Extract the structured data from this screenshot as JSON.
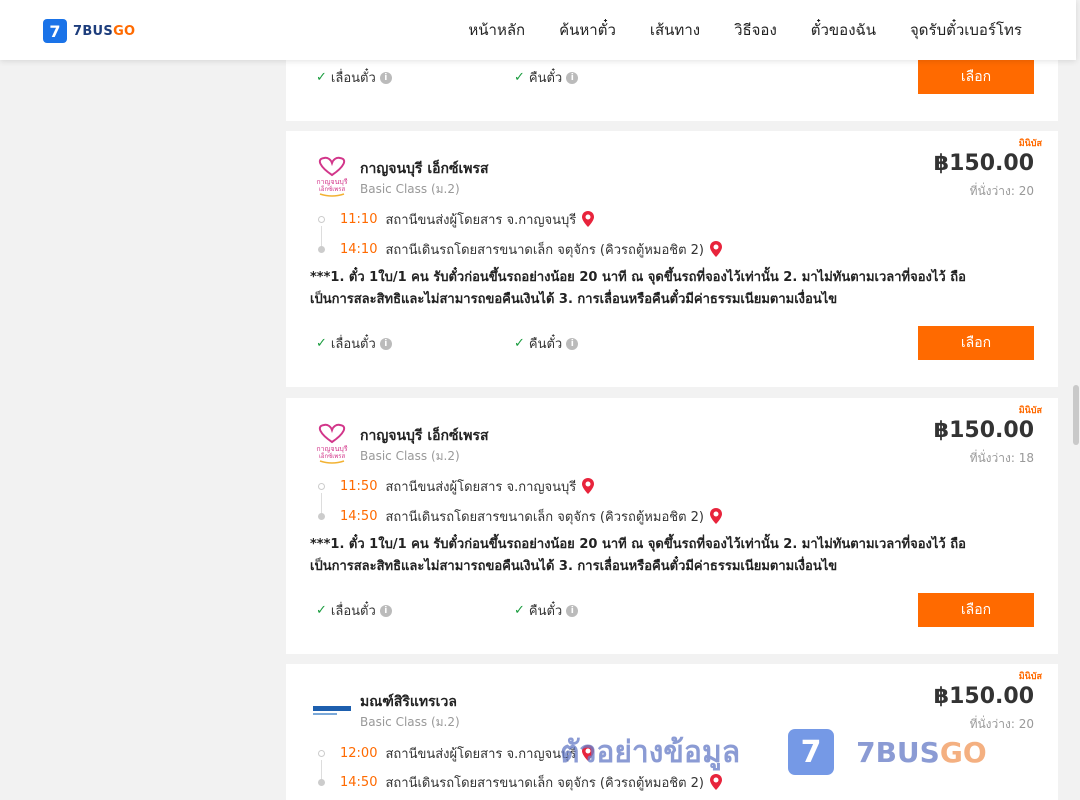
{
  "header": {
    "logo_mark": "7",
    "logo_text_1": "7BUS",
    "logo_text_2": "GO",
    "nav": [
      "หน้าหลัก",
      "ค้นหาตั๋ว",
      "เส้นทาง",
      "วิธีจอง",
      "ตั๋วของฉัน",
      "จุดรับตั๋วเบอร์โทร"
    ]
  },
  "options": {
    "change_label": "เลื่อนตั๋ว",
    "refund_label": "คืนตั๋ว",
    "info_glyph": "i",
    "check_glyph": "✓",
    "select_label": "เลือก"
  },
  "trips": [
    {
      "tag": "มินิบัส",
      "operator": "กาญจนบุรี เอ็กซ์เพรส",
      "class": "Basic Class (ม.2)",
      "price": "฿150.00",
      "seats": "ที่นั่งว่าง: 20",
      "depart_time": "11:10",
      "depart_station": "สถานีขนส่งผู้โดยสาร จ.กาญจนบุรี",
      "arrive_time": "14:10",
      "arrive_station": "สถานีเดินรถโดยสารขนาดเล็ก จตุจักร (คิวรถตู้หมอชิต 2)",
      "note_1": "***1. ตั๋ว 1ใบ/1 คน รับตั๋วก่อนขึ้นรถอย่างน้อย 20 นาที ณ จุดขึ้นรถที่จองไว้เท่านั้น 2. มาไม่ทันตามเวลาที่จองไว้ ถือ",
      "note_2": "เป็นการสละสิทธิและไม่สามารถขอคืนเงินได้ 3. การเลื่อนหรือคืนตั๋วมีค่าธรรมเนียมตามเงื่อนไข"
    },
    {
      "tag": "มินิบัส",
      "operator": "กาญจนบุรี เอ็กซ์เพรส",
      "class": "Basic Class (ม.2)",
      "price": "฿150.00",
      "seats": "ที่นั่งว่าง: 18",
      "depart_time": "11:50",
      "depart_station": "สถานีขนส่งผู้โดยสาร จ.กาญจนบุรี",
      "arrive_time": "14:50",
      "arrive_station": "สถานีเดินรถโดยสารขนาดเล็ก จตุจักร (คิวรถตู้หมอชิต 2)",
      "note_1": "***1. ตั๋ว 1ใบ/1 คน รับตั๋วก่อนขึ้นรถอย่างน้อย 20 นาที ณ จุดขึ้นรถที่จองไว้เท่านั้น 2. มาไม่ทันตามเวลาที่จองไว้ ถือ",
      "note_2": "เป็นการสละสิทธิและไม่สามารถขอคืนเงินได้ 3. การเลื่อนหรือคืนตั๋วมีค่าธรรมเนียมตามเงื่อนไข"
    },
    {
      "tag": "มินิบัส",
      "operator": "มณฑ์สิริแทรเวล",
      "class": "Basic Class (ม.2)",
      "price": "฿150.00",
      "seats": "ที่นั่งว่าง: 20",
      "depart_time": "12:00",
      "depart_station": "สถานีขนส่งผู้โดยสาร จ.กาญจนบุรี",
      "arrive_time": "14:50",
      "arrive_station": "สถานีเดินรถโดยสารขนาดเล็ก จตุจักร (คิวรถตู้หมอชิต 2)"
    }
  ],
  "watermark": {
    "text": "ตัวอย่างข้อมูล",
    "logo_mark": "7",
    "brand_1": "7BUS",
    "brand_2": "GO"
  },
  "colors": {
    "accent": "#ff6a00",
    "brand_blue": "#1a73e8",
    "check_green": "#1a9c3e"
  }
}
